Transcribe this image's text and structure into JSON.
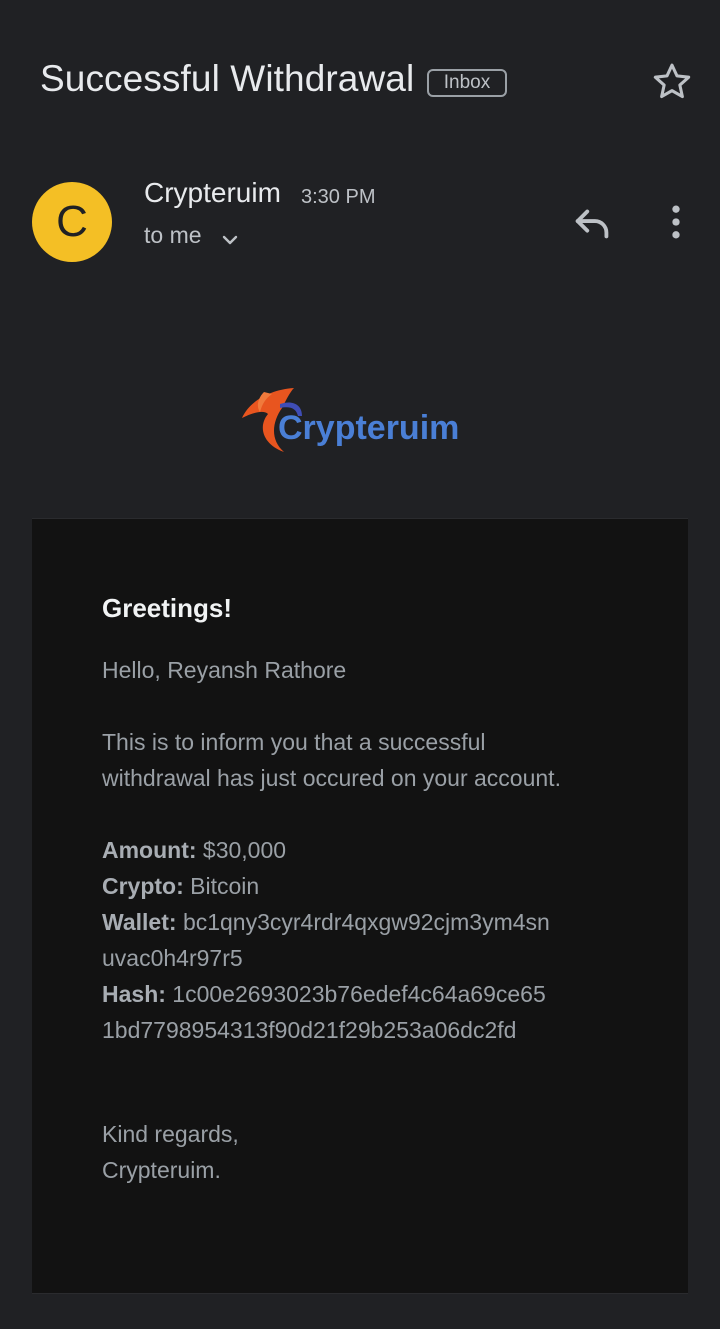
{
  "header": {
    "subject": "Successful Withdrawal",
    "label_badge": "Inbox"
  },
  "message": {
    "avatar_letter": "C",
    "sender": "Crypteruim",
    "time": "3:30 PM",
    "recipient": "to me"
  },
  "logo": {
    "text": "Crypteruim"
  },
  "body": {
    "greeting": "Greetings!",
    "salutation": "Hello, Reyansh Rathore",
    "intro_line1": "This is to inform you that a successful",
    "intro_line2": "withdrawal has just occured on your account.",
    "details": {
      "amount_label": "Amount:",
      "amount_value": "$30,000",
      "crypto_label": "Crypto:",
      "crypto_value": "Bitcoin",
      "wallet_label": "Wallet:",
      "wallet_value_line1": "bc1qny3cyr4rdr4qxgw92cjm3ym4sn",
      "wallet_value_line2": "uvac0h4r97r5",
      "hash_label": "Hash:",
      "hash_value_line1": "1c00e2693023b76edef4c64a69ce65",
      "hash_value_line2": "1bd7798954313f90d21f29b253a06dc2fd"
    },
    "closing": "Kind regards,",
    "signature": "Crypteruim."
  },
  "colors": {
    "background": "#202124",
    "avatar": "#f4bf25",
    "card": "#121212",
    "logo_orange": "#e8551f",
    "logo_blue": "#4a7fd6"
  }
}
